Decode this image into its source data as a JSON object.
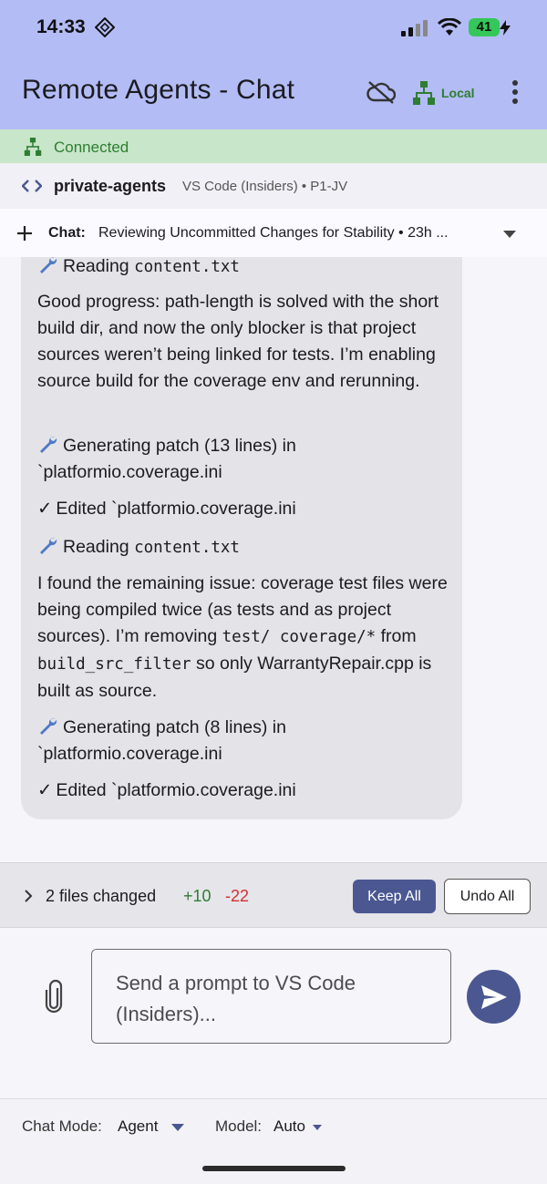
{
  "status_bar": {
    "time": "14:33",
    "battery": "41",
    "icons": [
      "location-icon",
      "signal-icon",
      "wifi-icon",
      "battery-bolt-icon"
    ]
  },
  "header": {
    "title": "Remote Agents - Chat",
    "local_label": "Local",
    "icons": [
      "cloud-off-icon",
      "network-icon",
      "more-vert-icon"
    ],
    "background": "#b3bcf5"
  },
  "connection": {
    "label": "Connected",
    "color": "#2e7d32",
    "background": "#c8e6c9"
  },
  "workspace": {
    "name": "private-agents",
    "meta": "VS Code (Insiders) • P1-JV"
  },
  "chat": {
    "label": "Chat:",
    "title": "Reviewing Uncommitted Changes for Stability • 23h ..."
  },
  "messages": {
    "m1_prefix": "Reading",
    "m1_code": "content.txt",
    "m2": "Good progress: path-length is solved with the short build dir, and now the only blocker is that project sources weren’t being linked for tests. I’m enabling source build for the coverage env and rerunning.",
    "m3": "Generating patch (13 lines) in `platformio.coverage.ini",
    "m4": "Edited `platformio.coverage.ini",
    "m5_prefix": "Reading",
    "m5_code": "content.txt",
    "m6_a": "I found the remaining issue: coverage test files were being compiled twice (as tests and as project sources). I’m removing",
    "m6_code1": "test/ coverage/*",
    "m6_b": "from",
    "m6_code2": "build_src_filter",
    "m6_c": "so only WarrantyRepair.cpp is built as source.",
    "m7": "Generating patch (8 lines) in `platformio.coverage.ini",
    "m8": "Edited `platformio.coverage.ini",
    "check_glyph": "✓"
  },
  "changes": {
    "files_changed": "2 files changed",
    "added": "+10",
    "removed": "-22",
    "keep_all": "Keep All",
    "undo_all": "Undo All"
  },
  "composer": {
    "placeholder": "Send a prompt to VS Code (Insiders)..."
  },
  "bottom": {
    "mode_label": "Chat Mode:",
    "mode_value": "Agent",
    "model_label": "Model:",
    "model_value": "Auto"
  },
  "colors": {
    "accent": "#4a5791",
    "added": "#2e7d32",
    "removed": "#d32f2f",
    "bubble": "#e3e3e8"
  }
}
